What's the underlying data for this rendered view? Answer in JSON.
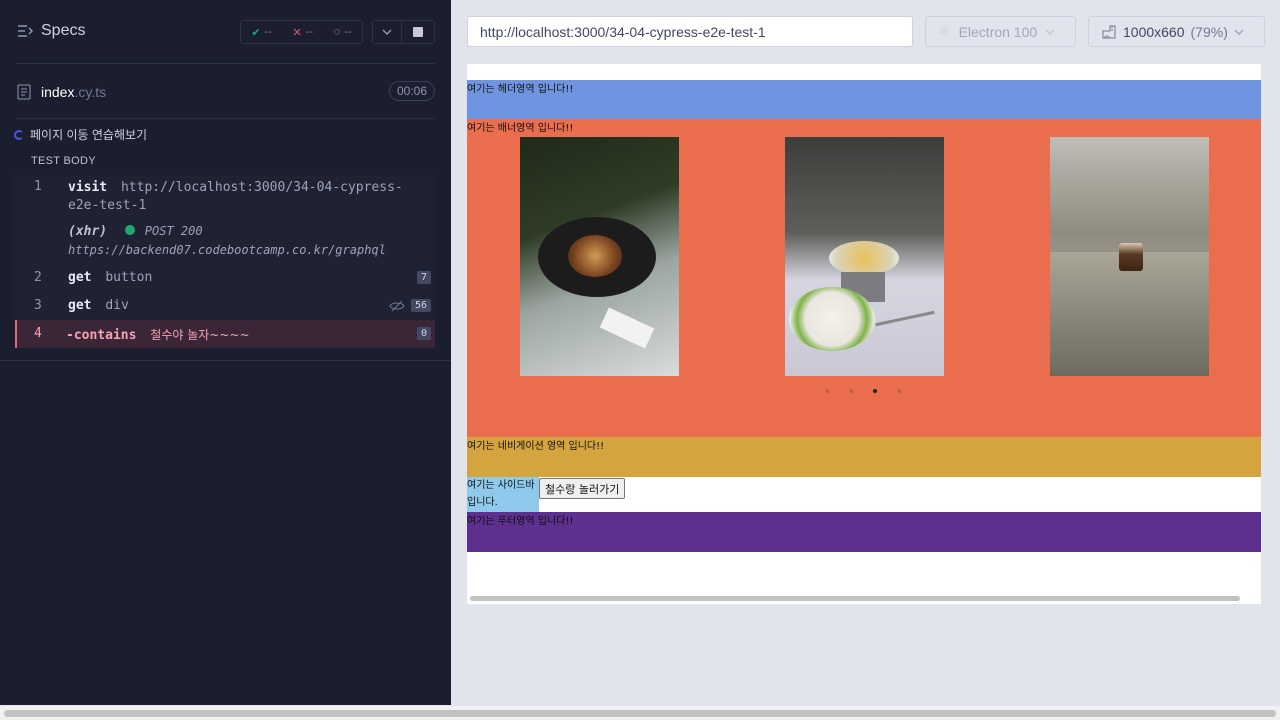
{
  "runner": {
    "specs_label": "Specs",
    "stats": {
      "passed": "--",
      "failed": "--",
      "pending": "--"
    },
    "file": {
      "name": "index",
      "ext": ".cy.ts",
      "duration": "00:06"
    },
    "suite_title": "페이지 이동 연습해보기",
    "test_body_label": "TEST BODY",
    "commands": [
      {
        "num": "1",
        "name": "visit",
        "arg": "http://localhost:3000/34-04-cypress-e2e-test-1"
      },
      {
        "xhr": "(xhr)",
        "method": "POST 200",
        "url": "https://backend07.codebootcamp.co.kr/graphql"
      },
      {
        "num": "2",
        "name": "get",
        "arg": "button",
        "count": "7"
      },
      {
        "num": "3",
        "name": "get",
        "arg": "div",
        "count": "56"
      },
      {
        "num": "4",
        "name": "-contains",
        "arg": "철수야 놀자~~~~",
        "count": "0"
      }
    ]
  },
  "toolbar": {
    "url": "http://localhost:3000/34-04-cypress-e2e-test-1",
    "browser": "Electron 100",
    "viewport": "1000x660",
    "zoom": "(79%)"
  },
  "app": {
    "header": "여기는 헤더영역 입니다!!",
    "banner": "여기는 배너영역 입니다!!",
    "nav": "여기는 네비게이션 영역 입니다!!",
    "sidebar": "여기는 사이드바입니다.",
    "button": "철수랑 놀러가기",
    "footer": "여기는 푸터영역 입니다!!"
  },
  "colors": {
    "header": "#6f95e0",
    "banner": "#ea6d4e",
    "nav": "#d4a43f",
    "sidebar": "#8fc9eb",
    "footer": "#5d2f8e"
  }
}
